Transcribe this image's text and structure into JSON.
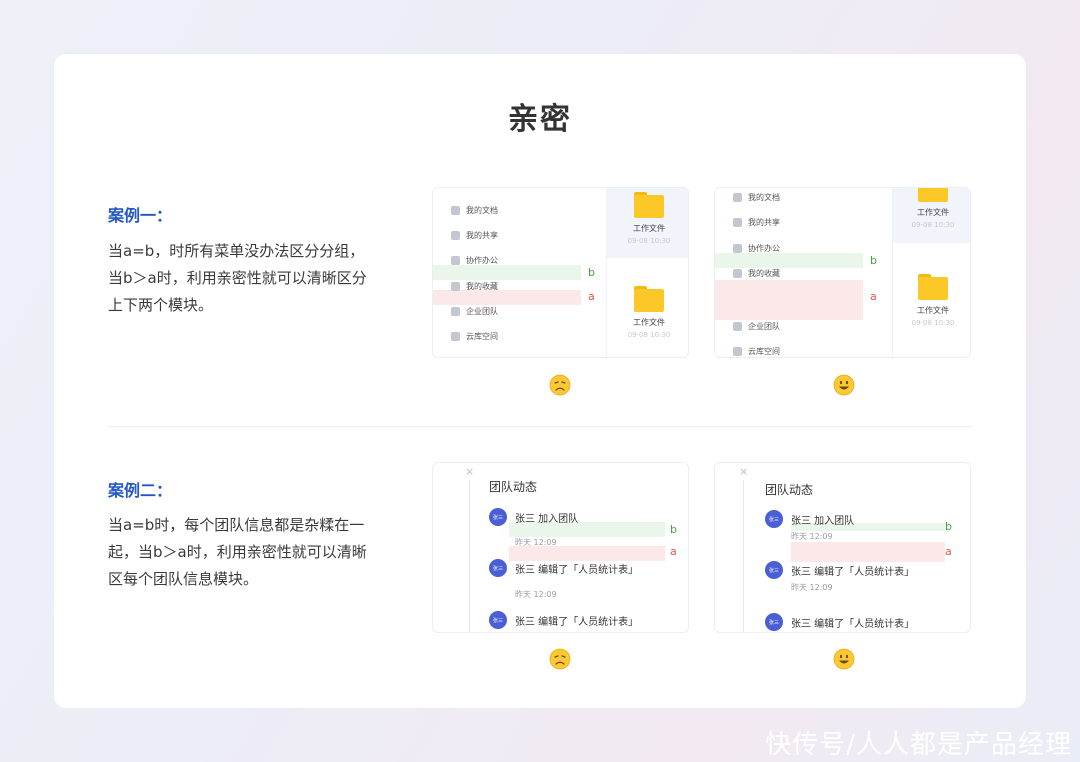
{
  "title": "亲密",
  "case1": {
    "heading": "案例一：",
    "description": "当a=b，时所有菜单没办法区分分组，当b＞a时，利用亲密性就可以清晰区分上下两个模块。",
    "menu": [
      "我的文档",
      "我的共享",
      "协作办公",
      "我的收藏",
      "企业团队",
      "云库空间"
    ],
    "file_name": "工作文件",
    "file_date": "09-08 10:30",
    "label_b": "b",
    "label_a": "a"
  },
  "case2": {
    "heading": "案例二：",
    "description": "当a=b时，每个团队信息都是杂糅在一起，当b＞a时，利用亲密性就可以清晰区每个团队信息模块。",
    "close_symbol": "×",
    "panel_title": "团队动态",
    "avatar_text": "张三",
    "feed": [
      {
        "text": "张三 加入团队",
        "time": "昨天 12:09"
      },
      {
        "text": "张三 编辑了「人员统计表」",
        "time": "昨天 12:09"
      },
      {
        "text": "张三 编辑了「人员统计表」"
      }
    ],
    "label_b": "b",
    "label_a": "a"
  },
  "emojis": {
    "bad": "disappointed-face-icon",
    "good": "smiling-face-icon"
  },
  "watermark": "快传号/人人都是产品经理",
  "colors": {
    "heading_blue": "#2457c5",
    "folder_yellow": "#fbc827",
    "avatar_blue": "#4a5fd6",
    "green_band": "#e9f6e9",
    "red_band": "#fbe8e8"
  }
}
